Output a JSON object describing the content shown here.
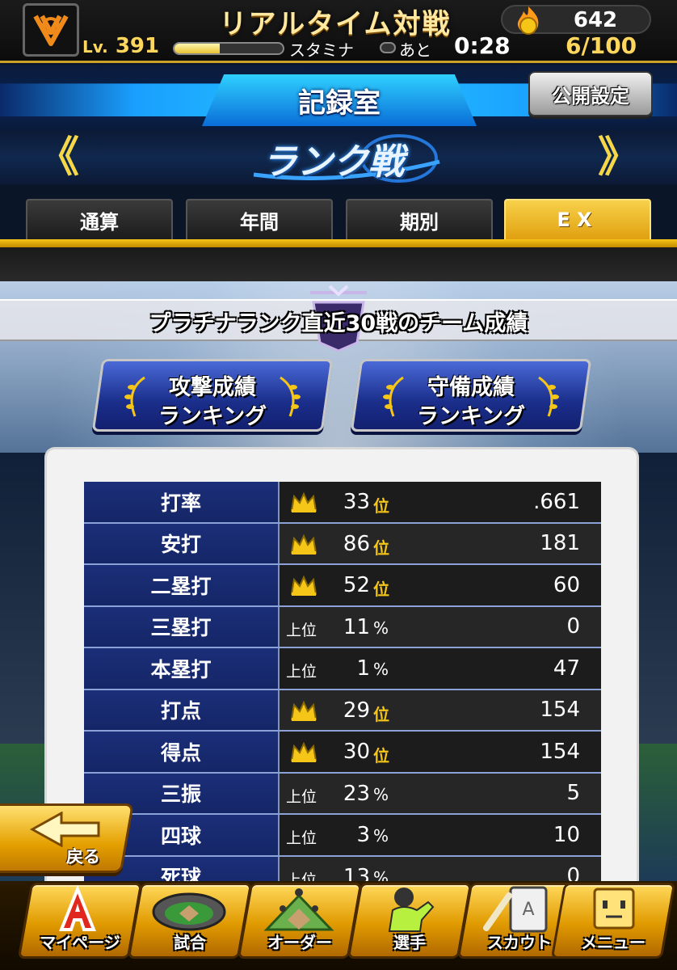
{
  "top_bar": {
    "mode_title": "リアルタイム対戦",
    "coins": "642",
    "level_prefix": "Lv.",
    "level": "391",
    "stamina_label": "スタミナ",
    "stamina_ato": "あと",
    "stamina_time": "0:28",
    "stamina_count": "6/100",
    "exp_progress": 0.42
  },
  "header": {
    "title": "記録室",
    "public_setting_label": "公開設定"
  },
  "rank_banner": {
    "title": "ランク戦",
    "prev_label": "《",
    "next_label": "》"
  },
  "tabs": [
    {
      "label": "通算",
      "active": false
    },
    {
      "label": "年間",
      "active": false
    },
    {
      "label": "期別",
      "active": false
    },
    {
      "label": "EX",
      "active": true
    }
  ],
  "subtitle": "プラチナランク直近30戦のチーム成績",
  "ranking_buttons": {
    "offense": {
      "line1": "攻撃成績",
      "line2": "ランキング"
    },
    "defense": {
      "line1": "守備成績",
      "line2": "ランキング"
    }
  },
  "stats": [
    {
      "label": "打率",
      "type": "rank",
      "rank": "33",
      "unit": "位",
      "value": ".661"
    },
    {
      "label": "安打",
      "type": "rank",
      "rank": "86",
      "unit": "位",
      "value": "181"
    },
    {
      "label": "二塁打",
      "type": "rank",
      "rank": "52",
      "unit": "位",
      "value": "60"
    },
    {
      "label": "三塁打",
      "type": "pct",
      "prefix": "上位",
      "rank": "11",
      "unit": "%",
      "value": "0"
    },
    {
      "label": "本塁打",
      "type": "pct",
      "prefix": "上位",
      "rank": "1",
      "unit": "%",
      "value": "47"
    },
    {
      "label": "打点",
      "type": "rank",
      "rank": "29",
      "unit": "位",
      "value": "154"
    },
    {
      "label": "得点",
      "type": "rank",
      "rank": "30",
      "unit": "位",
      "value": "154"
    },
    {
      "label": "三振",
      "type": "pct",
      "prefix": "上位",
      "rank": "23",
      "unit": "%",
      "value": "5"
    },
    {
      "label": "四球",
      "type": "pct",
      "prefix": "上位",
      "rank": "3",
      "unit": "%",
      "value": "10"
    },
    {
      "label": "死球",
      "type": "pct",
      "prefix": "上位",
      "rank": "13",
      "unit": "%",
      "value": "0"
    }
  ],
  "back_button": {
    "label": "戻る"
  },
  "bottom_nav": [
    {
      "label": "マイページ",
      "icon": "mypage-a-icon"
    },
    {
      "label": "試合",
      "icon": "stadium-icon"
    },
    {
      "label": "オーダー",
      "icon": "lineup-field-icon"
    },
    {
      "label": "選手",
      "icon": "player-icon"
    },
    {
      "label": "スカウト",
      "icon": "scout-card-icon"
    },
    {
      "label": "メニュー",
      "icon": "menu-character-icon"
    }
  ],
  "colors": {
    "accent_gold": "#f5c518",
    "header_blue": "#25c4ff",
    "table_label_bg": "#1b2e78",
    "crown": "#f5c518"
  }
}
